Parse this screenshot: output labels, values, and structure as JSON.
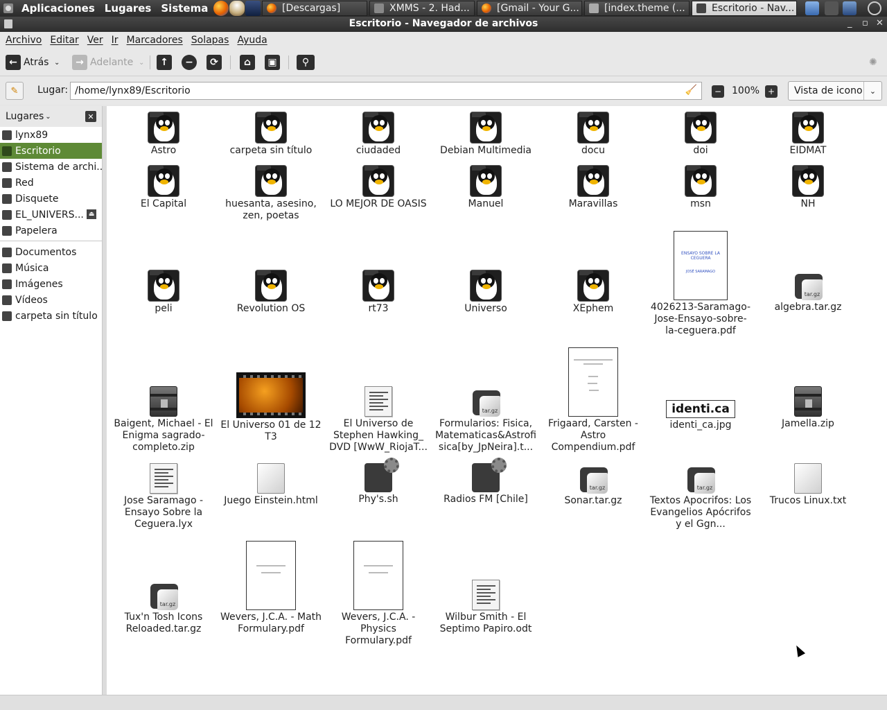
{
  "top_panel": {
    "menus": [
      "Aplicaciones",
      "Lugares",
      "Sistema"
    ],
    "tasks": [
      {
        "label": "[Descargas]",
        "icon": "firefox-icon",
        "active": false
      },
      {
        "label": "XMMS - 2. Had...",
        "icon": "xmms-icon",
        "active": false
      },
      {
        "label": "[Gmail - Your G...",
        "icon": "firefox-icon",
        "active": false
      },
      {
        "label": "[index.theme (...",
        "icon": "text-editor-icon",
        "active": false
      },
      {
        "label": "Escritorio - Nav...",
        "icon": "file-manager-icon",
        "active": true
      }
    ]
  },
  "window": {
    "title": "Escritorio - Navegador de archivos"
  },
  "menubar": [
    "Archivo",
    "Editar",
    "Ver",
    "Ir",
    "Marcadores",
    "Solapas",
    "Ayuda"
  ],
  "toolbar": {
    "back_label": "Atrás",
    "forward_label": "Adelante"
  },
  "location": {
    "label": "Lugar:",
    "path": "/home/lynx89/Escritorio",
    "zoom": "100%",
    "view_mode": "Vista de icono"
  },
  "sidebar": {
    "header": "Lugares",
    "places": [
      {
        "label": "lynx89",
        "icon": "home-icon"
      },
      {
        "label": "Escritorio",
        "icon": "desktop-icon",
        "selected": true
      },
      {
        "label": "Sistema de archi...",
        "icon": "filesystem-icon"
      },
      {
        "label": "Red",
        "icon": "network-icon"
      },
      {
        "label": "Disquete",
        "icon": "floppy-icon"
      },
      {
        "label": "EL_UNIVERS...",
        "icon": "disc-icon",
        "ejectable": true
      },
      {
        "label": "Papelera",
        "icon": "trash-icon"
      }
    ],
    "bookmarks": [
      {
        "label": "Documentos",
        "icon": "folder-icon"
      },
      {
        "label": "Música",
        "icon": "folder-icon"
      },
      {
        "label": "Imágenes",
        "icon": "folder-icon"
      },
      {
        "label": "Vídeos",
        "icon": "folder-icon"
      },
      {
        "label": "carpeta sin título",
        "icon": "folder-icon"
      }
    ]
  },
  "files": [
    {
      "name": "Astro",
      "type": "folder"
    },
    {
      "name": "carpeta sin título",
      "type": "folder"
    },
    {
      "name": "ciudaded",
      "type": "folder"
    },
    {
      "name": "Debian Multimedia",
      "type": "folder"
    },
    {
      "name": "docu",
      "type": "folder"
    },
    {
      "name": "doi",
      "type": "folder"
    },
    {
      "name": "EIDMAT",
      "type": "folder"
    },
    {
      "name": "El Capital",
      "type": "folder"
    },
    {
      "name": "huesanta, asesino, zen, poetas",
      "type": "folder"
    },
    {
      "name": "LO MEJOR DE OASIS",
      "type": "folder"
    },
    {
      "name": "Manuel",
      "type": "folder"
    },
    {
      "name": "Maravillas",
      "type": "folder"
    },
    {
      "name": "msn",
      "type": "folder"
    },
    {
      "name": "NH",
      "type": "folder"
    },
    {
      "name": "peli",
      "type": "folder"
    },
    {
      "name": "Revolution OS",
      "type": "folder"
    },
    {
      "name": "rt73",
      "type": "folder"
    },
    {
      "name": "Universo",
      "type": "folder"
    },
    {
      "name": "XEphem",
      "type": "folder"
    },
    {
      "name": "4026213-Saramago-Jose-Ensayo-sobre-la-ceguera.pdf",
      "type": "pdf"
    },
    {
      "name": "algebra.tar.gz",
      "type": "archive"
    },
    {
      "name": "Baigent, Michael - El Enigma sagrado-completo.zip",
      "type": "zip"
    },
    {
      "name": "El Universo 01 de 12 T3",
      "type": "video"
    },
    {
      "name": "El Universo de Stephen Hawking_ DVD [WwW_RiojaT...",
      "type": "text"
    },
    {
      "name": "Formularios: Fisica, Matematicas&Astrofisica[by_JpNeira].t...",
      "type": "archive"
    },
    {
      "name": "Frigaard, Carsten - Astro Compendium.pdf",
      "type": "pdf"
    },
    {
      "name": "identi_ca.jpg",
      "type": "image"
    },
    {
      "name": "Jamella.zip",
      "type": "zip"
    },
    {
      "name": "Jose Saramago - Ensayo Sobre la Ceguera.lyx",
      "type": "document"
    },
    {
      "name": "Juego Einstein.html",
      "type": "html"
    },
    {
      "name": "Phy's.sh",
      "type": "script"
    },
    {
      "name": "Radios FM [Chile]",
      "type": "script"
    },
    {
      "name": "Sonar.tar.gz",
      "type": "archive"
    },
    {
      "name": "Textos Apocrifos: Los Evangelios Apócrifos y el Ggn...",
      "type": "archive"
    },
    {
      "name": "Trucos Linux.txt",
      "type": "html"
    },
    {
      "name": "Tux'n Tosh Icons Reloaded.tar.gz",
      "type": "archive"
    },
    {
      "name": "Wevers, J.C.A. - Math Formulary.pdf",
      "type": "pdf"
    },
    {
      "name": "Wevers, J.C.A. - Physics Formulary.pdf",
      "type": "pdf"
    },
    {
      "name": "Wilbur Smith - El Septimo Papiro.odt",
      "type": "document"
    }
  ],
  "thumbnails": {
    "saramago_pdf": {
      "title": "ENSAYO SOBRE LA CEGUERA",
      "author": "JOSÉ SARAMAGO"
    },
    "identi_jpg": "identi.ca",
    "archive_tag": "tar.gz"
  },
  "colors": {
    "selection": "#5e8a36",
    "panel": "#333333",
    "window_bg": "#e8e8e8"
  }
}
